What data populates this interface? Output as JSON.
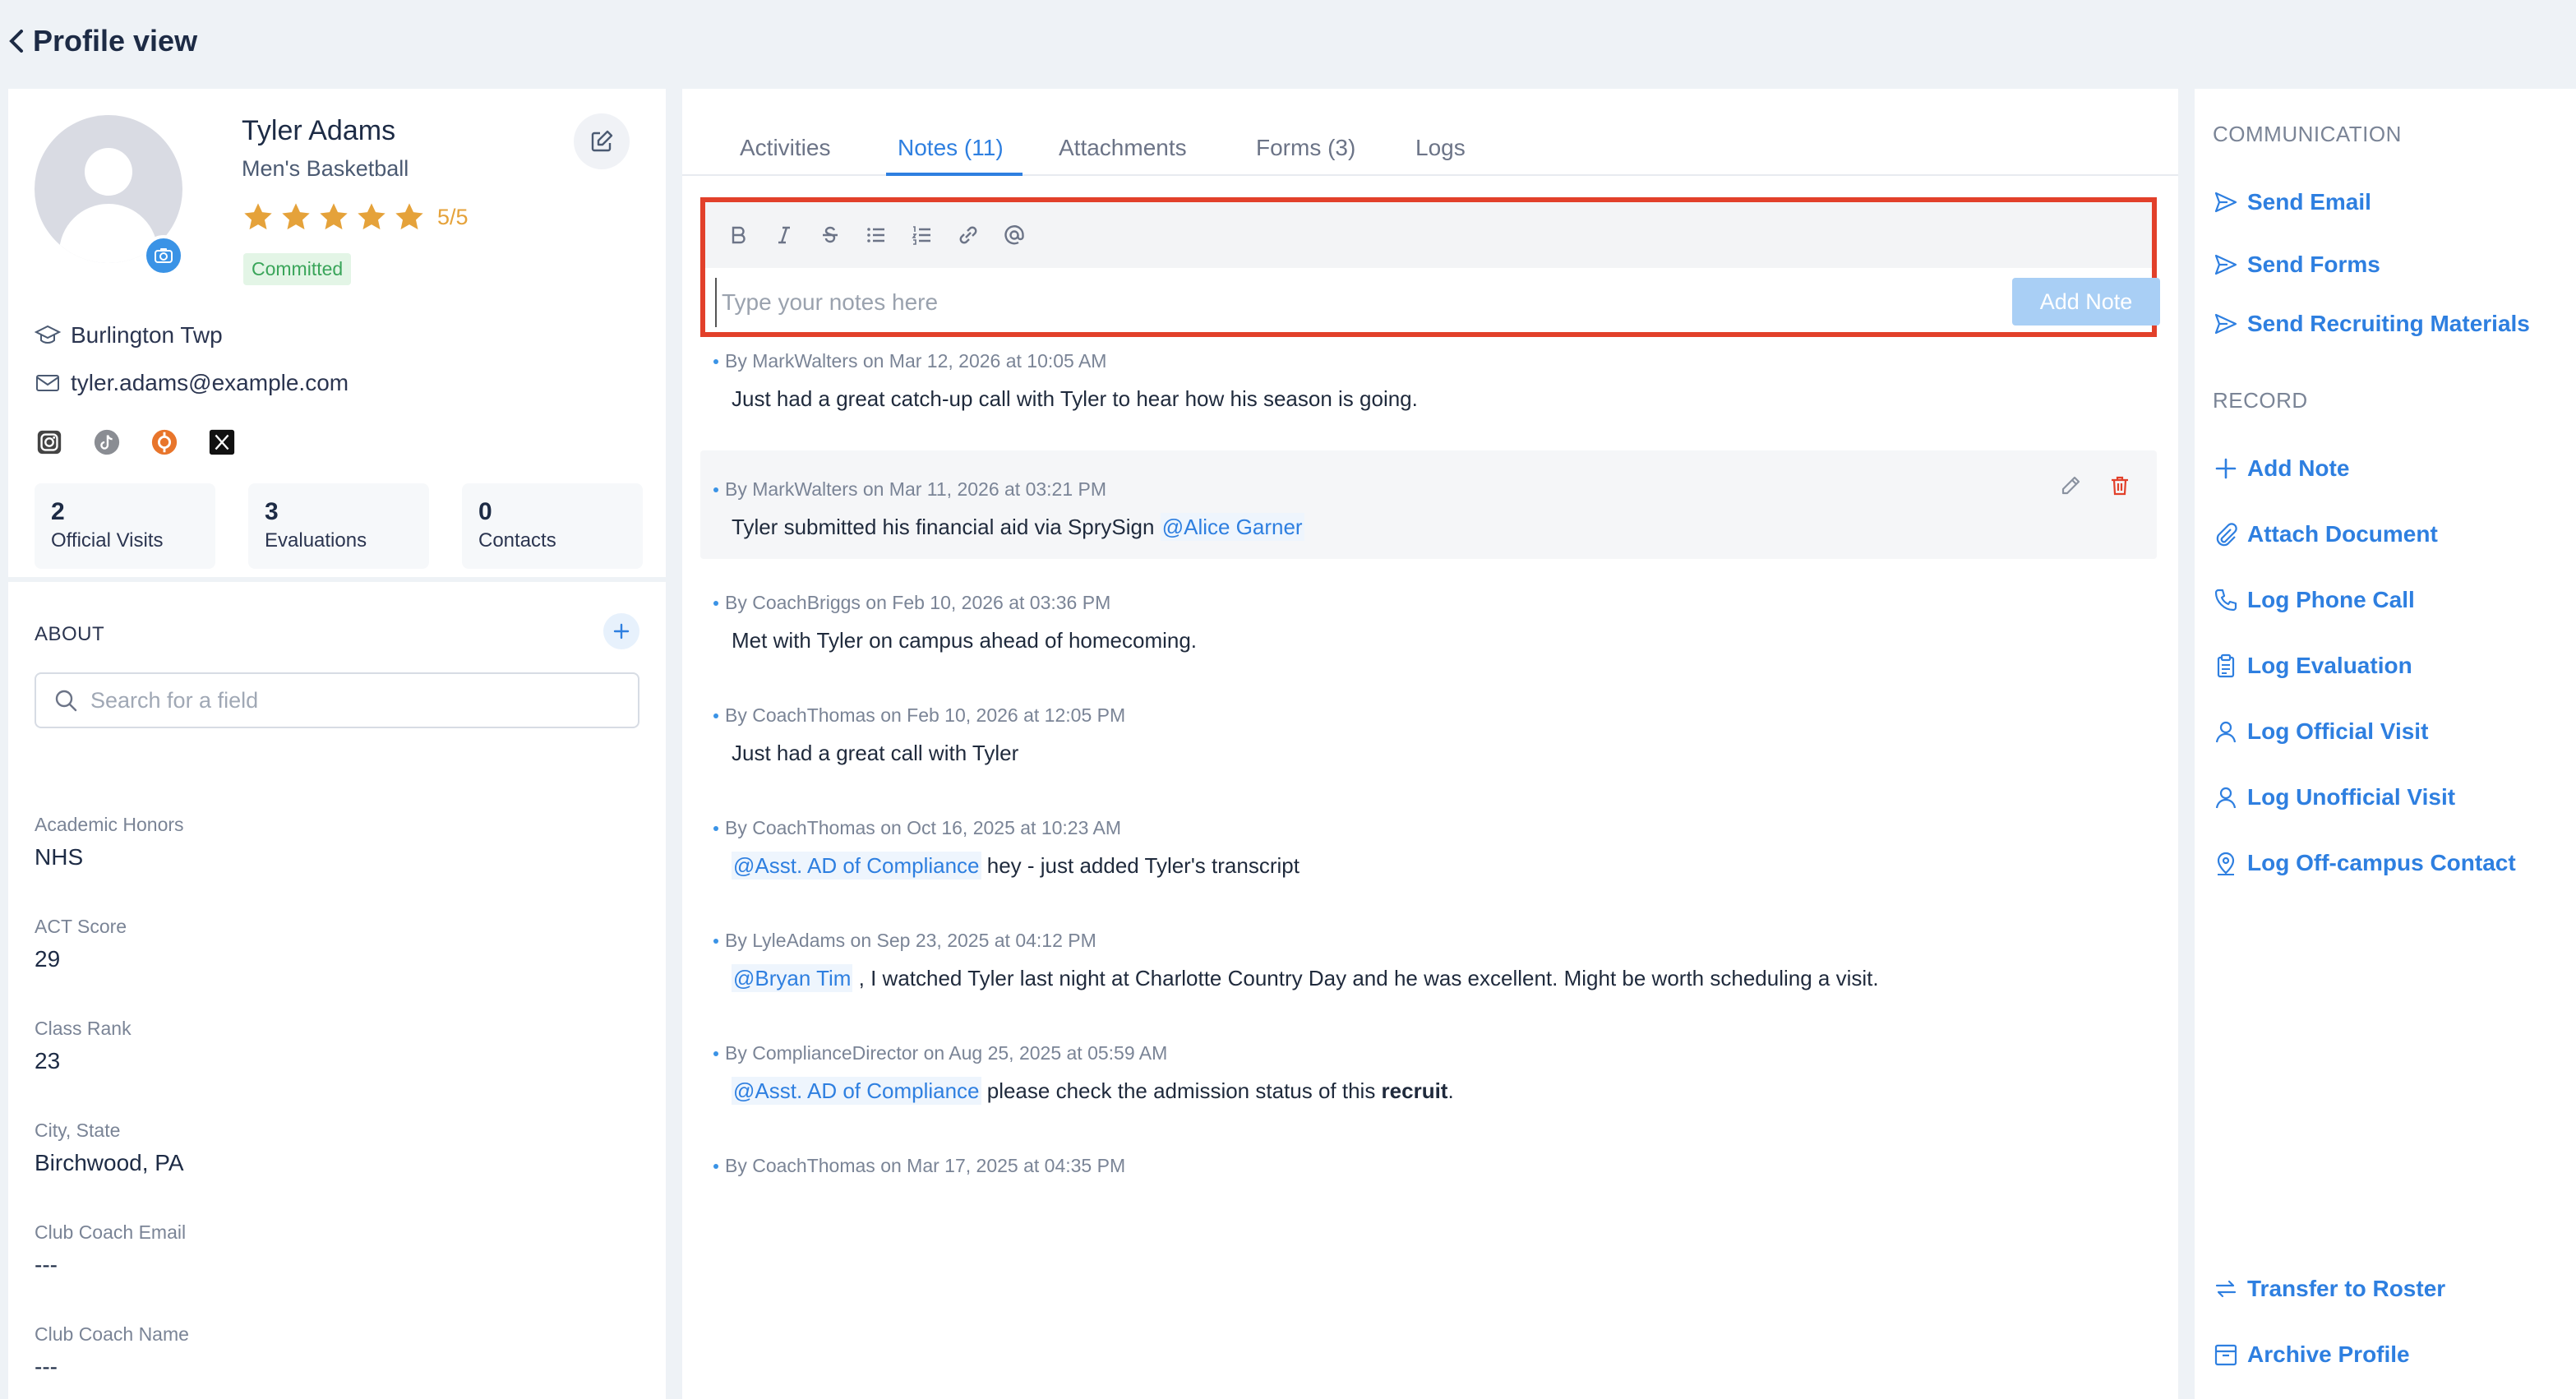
{
  "header": {
    "back_icon": "chevron-left-icon",
    "title": "Profile view"
  },
  "profile": {
    "name": "Tyler Adams",
    "sport": "Men's Basketball",
    "rating": "5/5",
    "stars": 5,
    "status": "Committed",
    "location": "Burlington Twp",
    "email": "tyler.adams@example.com",
    "socials": [
      "instagram-icon",
      "tiktok-icon",
      "hudl-icon",
      "x-icon"
    ],
    "stats": [
      {
        "value": "2",
        "label": "Official Visits"
      },
      {
        "value": "3",
        "label": "Evaluations"
      },
      {
        "value": "0",
        "label": "Contacts"
      }
    ]
  },
  "about": {
    "title": "ABOUT",
    "search_placeholder": "Search for a field",
    "fields": [
      {
        "label": "Academic Honors",
        "value": "NHS"
      },
      {
        "label": "ACT Score",
        "value": "29"
      },
      {
        "label": "Class Rank",
        "value": "23"
      },
      {
        "label": "City, State",
        "value": "Birchwood, PA"
      },
      {
        "label": "Club Coach Email",
        "value": "---"
      },
      {
        "label": "Club Coach Name",
        "value": "---"
      }
    ]
  },
  "tabs": [
    "Activities",
    "Notes (11)",
    "Attachments",
    "Forms (3)",
    "Logs"
  ],
  "active_tab": "Notes (11)",
  "editor": {
    "placeholder": "Type your notes here",
    "add_button": "Add Note",
    "tools": [
      "bold-icon",
      "italic-icon",
      "strikethrough-icon",
      "bullet-list-icon",
      "numbered-list-icon",
      "link-icon",
      "mention-icon"
    ]
  },
  "notes": [
    {
      "meta": "By MarkWalters on  Mar 12, 2026 at 10:05 AM",
      "text": "Just had a great catch-up call with Tyler to hear how his season is going."
    },
    {
      "meta": "By MarkWalters on  Mar 11, 2026 at 03:21 PM",
      "text_before": "Tyler submitted his financial aid via SprySign ",
      "mention": "@Alice Garner"
    },
    {
      "meta": "By CoachBriggs on  Feb 10, 2026 at 03:36 PM",
      "text": "Met with Tyler on campus ahead of homecoming."
    },
    {
      "meta": "By CoachThomas on  Feb 10, 2026 at 12:05 PM",
      "text": "Just had a great call with Tyler"
    },
    {
      "meta": "By CoachThomas on  Oct 16, 2025 at 10:23 AM",
      "mention": "@Asst. AD of Compliance",
      "text_after": " hey - just added Tyler's transcript"
    },
    {
      "meta": "By LyleAdams on  Sep 23, 2025 at 04:12 PM",
      "mention": "@Bryan Tim",
      "text_after": " , I watched Tyler last night at Charlotte Country Day and he was excellent. Might be worth scheduling a visit."
    },
    {
      "meta": "By ComplianceDirector on  Aug 25, 2025 at 05:59 AM",
      "mention": "@Asst. AD of Compliance",
      "text_after": " please check the admission status of this ",
      "bold": "recruit",
      "text_end": "."
    },
    {
      "meta": "By CoachThomas on  Mar 17, 2025 at 04:35 PM"
    }
  ],
  "sidebar": {
    "communication_title": "COMMUNICATION",
    "communication": [
      "Send Email",
      "Send Forms",
      "Send Recruiting Materials"
    ],
    "record_title": "RECORD",
    "record": [
      "Add Note",
      "Attach Document",
      "Log Phone Call",
      "Log Evaluation",
      "Log Official Visit",
      "Log Unofficial Visit",
      "Log Off-campus Contact"
    ],
    "bottom": [
      "Transfer to Roster",
      "Archive Profile"
    ]
  },
  "colors": {
    "accent": "#2e7fe0",
    "star": "#e5a23a",
    "danger": "#e2402a",
    "success": "#3aa55a"
  }
}
